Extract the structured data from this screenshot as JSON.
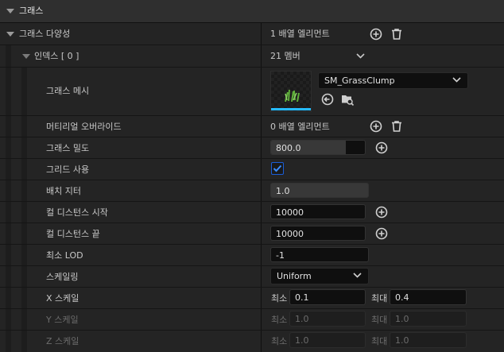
{
  "section": {
    "title": "그래스"
  },
  "grass_varieties": {
    "label": "그래스 다양성",
    "value": "1 배열 엘리먼트"
  },
  "index0": {
    "label": "인덱스 [ 0 ]",
    "value": "21 멤버"
  },
  "grass_mesh": {
    "label": "그래스 메시",
    "asset": "SM_GrassClump"
  },
  "material_overrides": {
    "label": "머티리얼 오버라이드",
    "value": "0 배열 엘리먼트"
  },
  "grass_density": {
    "label": "그래스 밀도",
    "value": "800.0",
    "fill_fraction": 0.8
  },
  "use_grid": {
    "label": "그리드 사용",
    "checked": true
  },
  "placement_jitter": {
    "label": "배치 지터",
    "value": "1.0",
    "fill_fraction": 1.0
  },
  "cull_start": {
    "label": "컬 디스턴스 시작",
    "value": "10000"
  },
  "cull_end": {
    "label": "컬 디스턴스 끝",
    "value": "10000"
  },
  "min_lod": {
    "label": "최소 LOD",
    "value": "-1"
  },
  "scaling": {
    "label": "스케일링",
    "value": "Uniform"
  },
  "x_scale": {
    "label": "X 스케일",
    "min_label": "최소",
    "min": "0.1",
    "max_label": "최대",
    "max": "0.4"
  },
  "y_scale": {
    "label": "Y 스케일",
    "min_label": "최소",
    "min": "1.0",
    "max_label": "최대",
    "max": "1.0"
  },
  "z_scale": {
    "label": "Z 스케일",
    "min_label": "최소",
    "min": "1.0",
    "max_label": "최대",
    "max": "1.0"
  },
  "colors": {
    "accent": "#26bbff",
    "checkbox": "#1a5ed8",
    "header": "#2f2f2f",
    "row": "#242424"
  }
}
